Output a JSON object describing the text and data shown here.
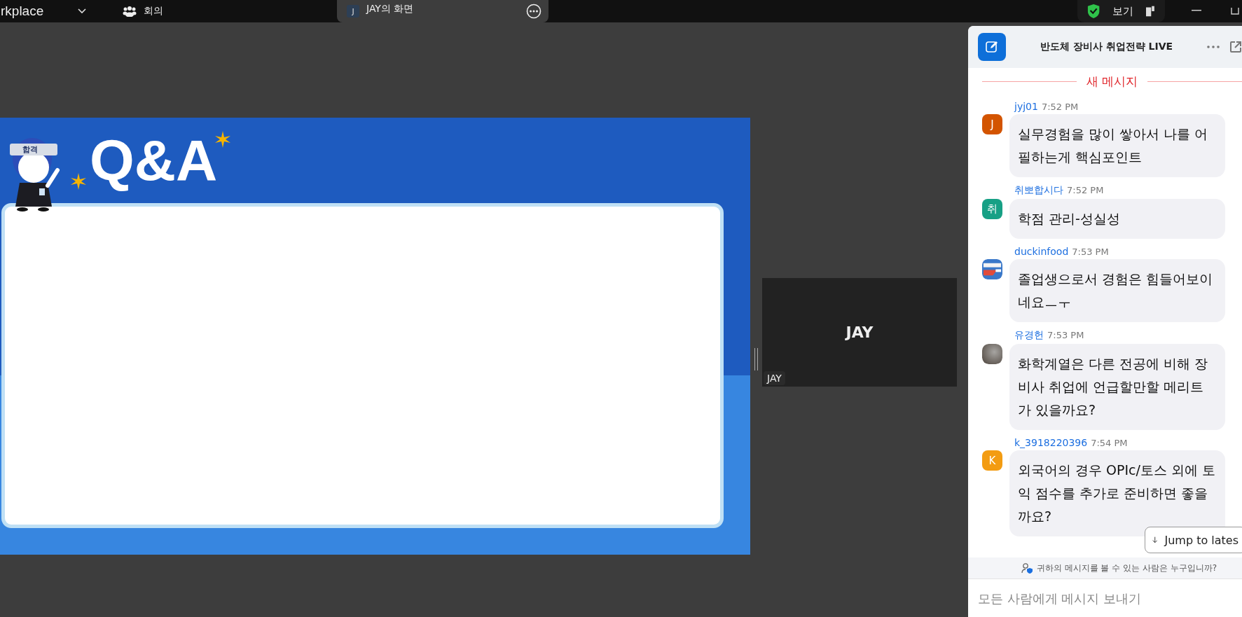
{
  "top_bar": {
    "app_name": "rkplace",
    "meeting_label": "회의",
    "share_tab": {
      "avatar": "J",
      "label": "JAY의 화면"
    },
    "view_button": "보기"
  },
  "slide": {
    "title": "Q&A",
    "badge": "합격"
  },
  "video_tile": {
    "name": "JAY",
    "label": "JAY"
  },
  "chat": {
    "title": "반도체 장비사 취업전략 LIVE",
    "new_divider": "새 메시지",
    "messages": [
      {
        "sender": "jyj01",
        "time": "7:52 PM",
        "avatar": {
          "kind": "letter",
          "letter": "J",
          "color": "#d35400"
        },
        "text": "실무경험을 많이 쌓아서 나를 어필하는게 핵심포인트"
      },
      {
        "sender": "취뽀합시다",
        "time": "7:52 PM",
        "avatar": {
          "kind": "letter",
          "letter": "취",
          "color": "#17a085"
        },
        "text": "학점 관리-성실성"
      },
      {
        "sender": "duckinfood",
        "time": "7:53 PM",
        "text": "졸업생으로서 경험은 힘들어보이네요ㅡㅜ"
      },
      {
        "sender": "유경헌",
        "time": "7:53 PM",
        "avatar": {
          "kind": "photo"
        },
        "text": "화학계열은 다른 전공에 비해 장비사 취업에 언급할만할 메리트가 있을까요?"
      },
      {
        "sender": "k_3918220396",
        "time": "7:54 PM",
        "avatar": {
          "kind": "letter",
          "letter": "K",
          "color": "#f39c12"
        },
        "text": "외국어의 경우 OPIc/토스 외에 토익 점수를 추가로 준비하면 좋을까요?"
      }
    ],
    "jump_button": "Jump to lates",
    "visibility_note": "귀하의 메시지를 볼 수 있는 사람은 누구입니까?",
    "input": {
      "placeholder": "모든 사람에게 메시지 보내기"
    }
  }
}
